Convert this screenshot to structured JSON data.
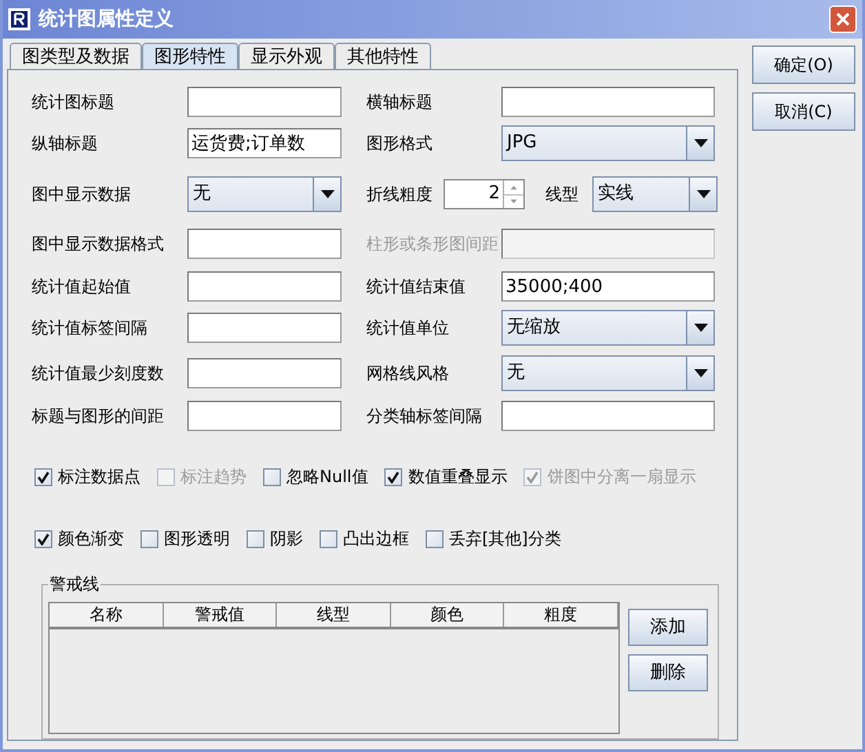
{
  "window": {
    "title": "统计图属性定义"
  },
  "tabs": [
    {
      "label": "图类型及数据",
      "selected": false
    },
    {
      "label": "图形特性",
      "selected": true
    },
    {
      "label": "显示外观",
      "selected": false
    },
    {
      "label": "其他特性",
      "selected": false
    }
  ],
  "side_buttons": [
    {
      "label": "确定(O)"
    },
    {
      "label": "取消(C)"
    }
  ],
  "form_rows": [
    {
      "items": [
        {
          "kind": "text",
          "label": "统计图标题",
          "disabled": false
        },
        {
          "kind": "text",
          "label": "横轴标题",
          "disabled": false
        }
      ]
    },
    {
      "items": [
        {
          "kind": "text",
          "label": "纵轴标题",
          "value": "运货费;订单数",
          "disabled": false
        },
        {
          "kind": "combo",
          "label": "图形格式",
          "value": "JPG",
          "disabled": false
        }
      ]
    },
    {
      "items": [
        {
          "kind": "combo",
          "label": "图中显示数据",
          "value": "无",
          "disabled": false
        },
        {
          "kind": "spinner",
          "label": "折线粗度",
          "value": "2",
          "disabled": false
        },
        {
          "kind": "combo",
          "label": "线型",
          "value": "实线",
          "disabled": false
        }
      ]
    },
    {
      "items": [
        {
          "kind": "text",
          "label": "图中显示数据格式",
          "disabled": false
        },
        {
          "kind": "text",
          "label": "柱形或条形图间距",
          "disabled": true
        }
      ]
    },
    {
      "items": [
        {
          "kind": "text",
          "label": "统计值起始值",
          "disabled": false
        },
        {
          "kind": "text",
          "label": "统计值结束值",
          "value": "35000;400",
          "disabled": false
        }
      ]
    },
    {
      "items": [
        {
          "kind": "text",
          "label": "统计值标签间隔",
          "disabled": false
        },
        {
          "kind": "combo",
          "label": "统计值单位",
          "value": "无缩放",
          "disabled": false
        }
      ]
    },
    {
      "items": [
        {
          "kind": "text",
          "label": "统计值最少刻度数",
          "disabled": false
        },
        {
          "kind": "combo",
          "label": "网格线风格",
          "value": "无",
          "disabled": false
        }
      ]
    },
    {
      "items": [
        {
          "kind": "text",
          "label": "标题与图形的间距",
          "disabled": false
        },
        {
          "kind": "text",
          "label": "分类轴标签间隔",
          "disabled": false
        }
      ]
    }
  ],
  "checkbox_rows": [
    [
      {
        "label": "标注数据点",
        "checked": true,
        "disabled": false
      },
      {
        "label": "标注趋势",
        "checked": false,
        "disabled": true
      },
      {
        "label": "忽略Null值",
        "checked": false,
        "disabled": false
      },
      {
        "label": "数值重叠显示",
        "checked": true,
        "disabled": false
      },
      {
        "label": "饼图中分离一扇显示",
        "checked": true,
        "disabled": true
      }
    ],
    [
      {
        "label": "颜色渐变",
        "checked": true,
        "disabled": false
      },
      {
        "label": "图形透明",
        "checked": false,
        "disabled": false
      },
      {
        "label": "阴影",
        "checked": false,
        "disabled": false
      },
      {
        "label": "凸出边框",
        "checked": false,
        "disabled": false
      },
      {
        "label": "丢弃[其他]分类",
        "checked": false,
        "disabled": false
      }
    ]
  ],
  "warning_lines": {
    "title": "警戒线",
    "columns": [
      "名称",
      "警戒值",
      "线型",
      "颜色",
      "粗度"
    ],
    "buttons": [
      {
        "label": "添加"
      },
      {
        "label": "删除"
      }
    ]
  }
}
